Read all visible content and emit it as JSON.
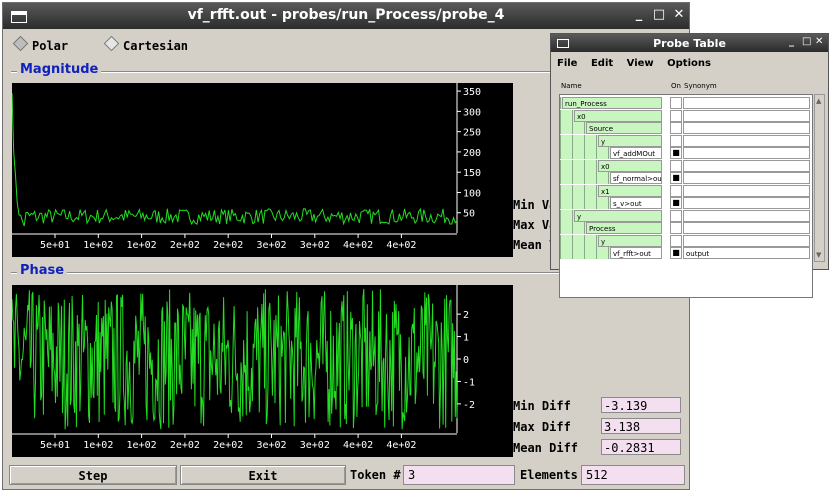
{
  "main_window": {
    "title": "vf_rfft.out - probes/run_Process/probe_4",
    "controls": {
      "minimize": "_",
      "maximize": "□",
      "close": "✕"
    },
    "mode_options": [
      {
        "label": "Polar",
        "selected": true
      },
      {
        "label": "Cartesian",
        "selected": false
      }
    ],
    "magnitude": {
      "group_label": "Magnitude",
      "stats": {
        "min_label": "Min Va",
        "max_label": "Max Va",
        "mean_label": "Mean V"
      }
    },
    "phase": {
      "group_label": "Phase",
      "stats": {
        "min_label": "Min Diff",
        "min_value": "-3.139",
        "max_label": "Max Diff",
        "max_value": "3.138",
        "mean_label": "Mean Diff",
        "mean_value": "-0.2831"
      }
    },
    "bottom_bar": {
      "step_label": "Step",
      "exit_label": "Exit",
      "token_label": "Token #",
      "token_value": "3",
      "elements_label": "Elements",
      "elements_value": "512"
    }
  },
  "probe_table": {
    "title": "Probe Table",
    "controls": {
      "minimize": "_",
      "maximize": "□",
      "close": "✕"
    },
    "menu": [
      "File",
      "Edit",
      "View",
      "Options"
    ],
    "header": {
      "name": "Name",
      "on": "On",
      "synonym": "Synonym"
    },
    "rows": [
      {
        "label": "run_Process",
        "indent": 0,
        "on": false,
        "synonym": ""
      },
      {
        "label": "x0",
        "indent": 1,
        "on": false,
        "synonym": ""
      },
      {
        "label": "Source",
        "indent": 2,
        "on": false,
        "synonym": ""
      },
      {
        "label": "y",
        "indent": 3,
        "on": false,
        "synonym": ""
      },
      {
        "label": "vf_addMOut",
        "indent": 4,
        "on": true,
        "synonym": ""
      },
      {
        "label": "x0",
        "indent": 3,
        "on": false,
        "synonym": ""
      },
      {
        "label": "sf_normal>out",
        "indent": 4,
        "on": true,
        "synonym": ""
      },
      {
        "label": "x1",
        "indent": 3,
        "on": false,
        "synonym": ""
      },
      {
        "label": "s_v>out",
        "indent": 4,
        "on": true,
        "synonym": ""
      },
      {
        "label": "y",
        "indent": 1,
        "on": false,
        "synonym": ""
      },
      {
        "label": "Process",
        "indent": 2,
        "on": false,
        "synonym": ""
      },
      {
        "label": "y",
        "indent": 3,
        "on": false,
        "synonym": ""
      },
      {
        "label": "vf_rfft>out",
        "indent": 4,
        "on": true,
        "synonym": "output"
      }
    ]
  },
  "chart_data": [
    {
      "type": "line",
      "title": "Magnitude",
      "x_tick_labels": [
        "5e+01",
        "1e+02",
        "1e+02",
        "2e+02",
        "2e+02",
        "3e+02",
        "3e+02",
        "4e+02",
        "4e+02"
      ],
      "y_ticks": [
        50,
        100,
        150,
        200,
        250,
        300,
        350
      ],
      "ylim": [
        0,
        370
      ],
      "xlim": [
        0,
        512
      ],
      "series": [
        {
          "color": "#22dd22",
          "shape": "spike at start decaying to noise floor ~25-55",
          "start_value": 345
        }
      ]
    },
    {
      "type": "line",
      "title": "Phase",
      "x_tick_labels": [
        "5e+01",
        "1e+02",
        "1e+02",
        "2e+02",
        "2e+02",
        "3e+02",
        "3e+02",
        "4e+02",
        "4e+02"
      ],
      "y_ticks": [
        -2,
        -1,
        0,
        1,
        2
      ],
      "ylim": [
        -3.3,
        3.3
      ],
      "xlim": [
        0,
        512
      ],
      "series": [
        {
          "color": "#22dd22",
          "shape": "dense oscillation between -3.14 and 3.14"
        }
      ]
    }
  ]
}
